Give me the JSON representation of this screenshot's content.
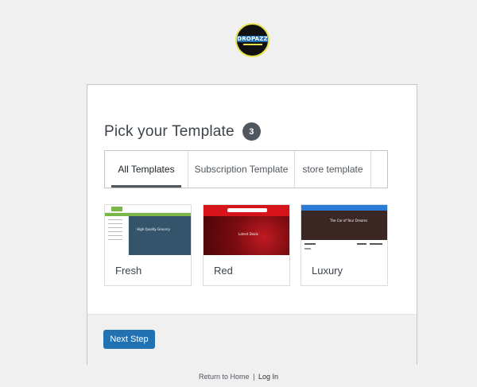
{
  "logo": {
    "text": "DROPAZZ",
    "icon": "brand-logo"
  },
  "wizard": {
    "title": "Pick your Template",
    "count": "3",
    "tabs": [
      {
        "label": "All Templates",
        "active": true
      },
      {
        "label": "Subscription Template",
        "active": false
      },
      {
        "label": "store template",
        "active": false
      }
    ],
    "templates": [
      {
        "name": "Fresh",
        "preview_caption": "High Quality Grocery"
      },
      {
        "name": "Red",
        "preview_caption": "Latest Deals"
      },
      {
        "name": "Luxury",
        "preview_caption": "The Car of Your Dreams"
      }
    ],
    "next_label": "Next Step"
  },
  "footer": {
    "home_link": "Return to Home",
    "separator": "|",
    "login_link": "Log In"
  },
  "colors": {
    "background": "#f0f0f1",
    "primary_button": "#2271b1",
    "badge": "#50575e"
  }
}
